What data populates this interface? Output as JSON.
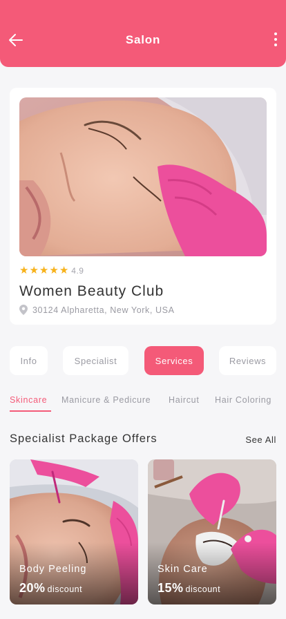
{
  "header": {
    "title": "Salon",
    "back_icon": "arrow-left-icon",
    "menu_icon": "more-vertical-icon",
    "background": "#f45a78"
  },
  "salon": {
    "image": "facial-treatment-photo",
    "rating_stars": 5,
    "rating_value": "4.9",
    "name": "Women Beauty Club",
    "address_icon": "location-pin-icon",
    "address": "30124 Alpharetta, New York, USA"
  },
  "tabs": [
    {
      "label": "Info",
      "active": false
    },
    {
      "label": "Specialist",
      "active": false
    },
    {
      "label": "Services",
      "active": true
    },
    {
      "label": "Reviews",
      "active": false
    }
  ],
  "subtabs": [
    {
      "label": "Skincare",
      "active": true
    },
    {
      "label": "Manicure & Pedicure",
      "active": false
    },
    {
      "label": "Haircut",
      "active": false
    },
    {
      "label": "Hair Coloring",
      "active": false
    }
  ],
  "offers_section": {
    "title": "Specialist Package Offers",
    "see_all": "See All"
  },
  "offers": [
    {
      "name": "Body Peeling",
      "percent": "20%",
      "discount_word": "discount",
      "image": "facial-peeling-photo"
    },
    {
      "name": "Skin Care",
      "percent": "15%",
      "discount_word": "discount",
      "image": "eyelash-treatment-photo"
    }
  ],
  "colors": {
    "accent": "#f45a78",
    "star": "#f7b21b",
    "muted_text": "#9a9aa2",
    "glove": "#ec4f9c"
  }
}
